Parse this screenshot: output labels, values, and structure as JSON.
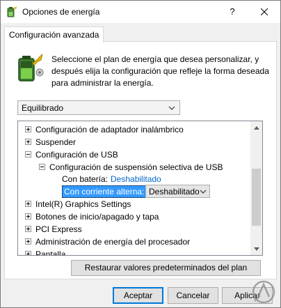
{
  "window": {
    "title": "Opciones de energía",
    "help_label": "?",
    "close_icon": "close-icon",
    "app_icon": "power-options-icon"
  },
  "tab": {
    "label": "Configuración avanzada"
  },
  "description": "Seleccione el plan de energía que desea personalizar, y después elija la configuración que refleje la forma deseada para administrar la energía.",
  "plan_select": {
    "value": "Equilibrado"
  },
  "tree": {
    "items": [
      {
        "label": "Configuración de adaptador inalámbrico",
        "expander": "plus"
      },
      {
        "label": "Suspender",
        "expander": "plus"
      },
      {
        "label": "Configuración de USB",
        "expander": "minus"
      },
      {
        "label": "Configuración de suspensión selectiva de USB",
        "expander": "minus"
      },
      {
        "label": "Con batería:",
        "value": "Deshabilitado"
      },
      {
        "label": "Con corriente alterna:",
        "value": "Deshabilitado",
        "selected": true
      },
      {
        "label": "Intel(R) Graphics Settings",
        "expander": "plus"
      },
      {
        "label": "Botones de inicio/apagado y tapa",
        "expander": "plus"
      },
      {
        "label": "PCI Express",
        "expander": "plus"
      },
      {
        "label": "Administración de energía del procesador",
        "expander": "plus"
      },
      {
        "label": "Pantalla",
        "expander": "plus"
      }
    ]
  },
  "buttons": {
    "restore": "Restaurar valores predeterminados del plan",
    "ok": "Aceptar",
    "cancel": "Cancelar",
    "apply": "Aplicar"
  },
  "colors": {
    "link": "#0066cc",
    "selection": "#3399ff",
    "default_button_border": "#0078d7"
  }
}
